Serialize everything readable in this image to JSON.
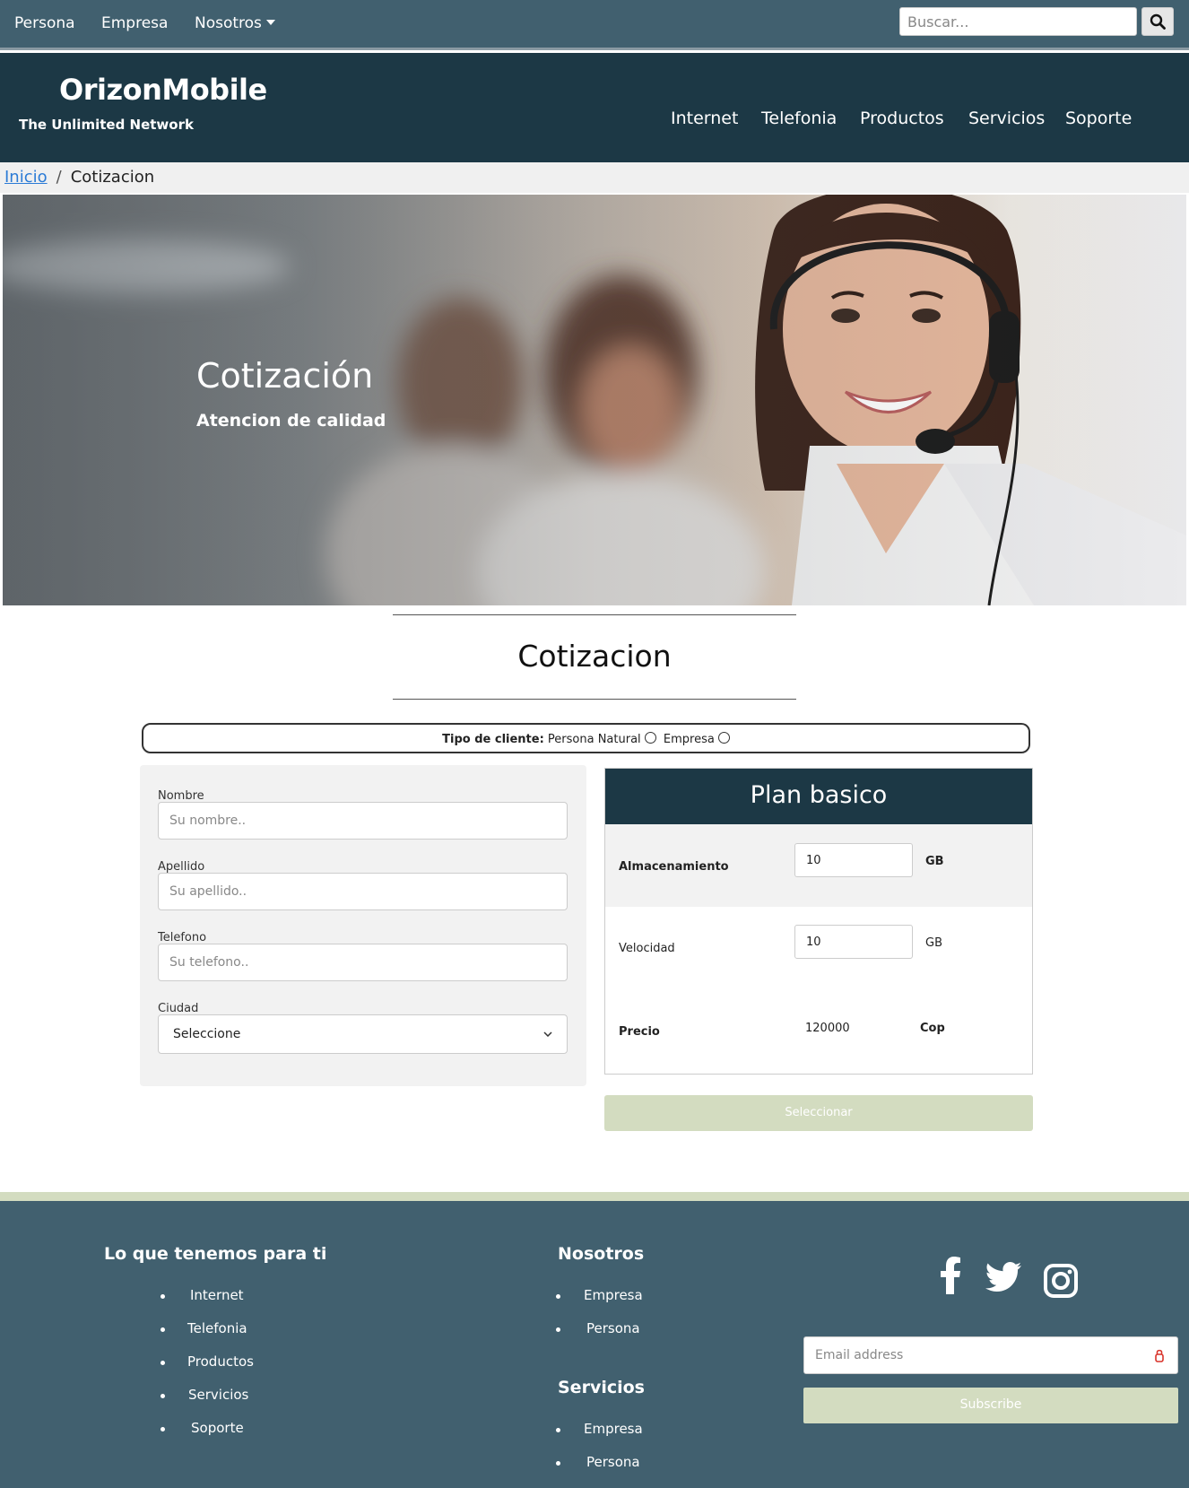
{
  "topnav": {
    "items": [
      {
        "label": "Persona"
      },
      {
        "label": "Empresa"
      },
      {
        "label": "Nosotros"
      }
    ],
    "search_placeholder": "Buscar..."
  },
  "header": {
    "brand": "OrizonMobile",
    "tagline": "The Unlimited Network",
    "nav": [
      {
        "label": "Internet"
      },
      {
        "label": "Telefonia"
      },
      {
        "label": "Productos"
      },
      {
        "label": "Servicios"
      },
      {
        "label": "Soporte"
      }
    ]
  },
  "breadcrumb": {
    "home": "Inicio",
    "separator": "/",
    "current": "Cotizacion"
  },
  "hero": {
    "title": "Cotización",
    "subtitle": "Atencion de calidad"
  },
  "section": {
    "title": "Cotizacion"
  },
  "client_type": {
    "label": "Tipo de cliente:",
    "options": [
      {
        "label": "Persona Natural",
        "selected": false
      },
      {
        "label": "Empresa",
        "selected": false
      }
    ]
  },
  "form": {
    "nombre": {
      "label": "Nombre",
      "placeholder": "Su nombre.."
    },
    "apellido": {
      "label": "Apellido",
      "placeholder": "Su apellido.."
    },
    "telefono": {
      "label": "Telefono",
      "placeholder": "Su telefono.."
    },
    "ciudad": {
      "label": "Ciudad",
      "value": "Seleccione"
    }
  },
  "plan": {
    "title": "Plan basico",
    "almacenamiento": {
      "label": "Almacenamiento",
      "value": "10",
      "unit": "GB"
    },
    "velocidad": {
      "label": "Velocidad",
      "value": "10",
      "unit": "GB"
    },
    "precio": {
      "label": "Precio",
      "value": "120000",
      "unit": "Cop"
    },
    "button": "Seleccionar"
  },
  "footer": {
    "col1": {
      "heading": "Lo que tenemos para ti",
      "items": [
        "Internet",
        "Telefonia",
        "Productos",
        "Servicios",
        "Soporte"
      ]
    },
    "col2": {
      "heading": "Nosotros",
      "items": [
        "Empresa",
        "Persona"
      ]
    },
    "col3": {
      "heading": "Servicios",
      "items": [
        "Empresa",
        "Persona"
      ]
    },
    "social": [
      "facebook-icon",
      "twitter-icon",
      "instagram-icon"
    ],
    "email_placeholder": "Email address",
    "subscribe": "Subscribe"
  },
  "colors": {
    "topbar": "#41606f",
    "header": "#1c3845",
    "accent": "#d3dcc0",
    "link": "#2b7bd6"
  }
}
